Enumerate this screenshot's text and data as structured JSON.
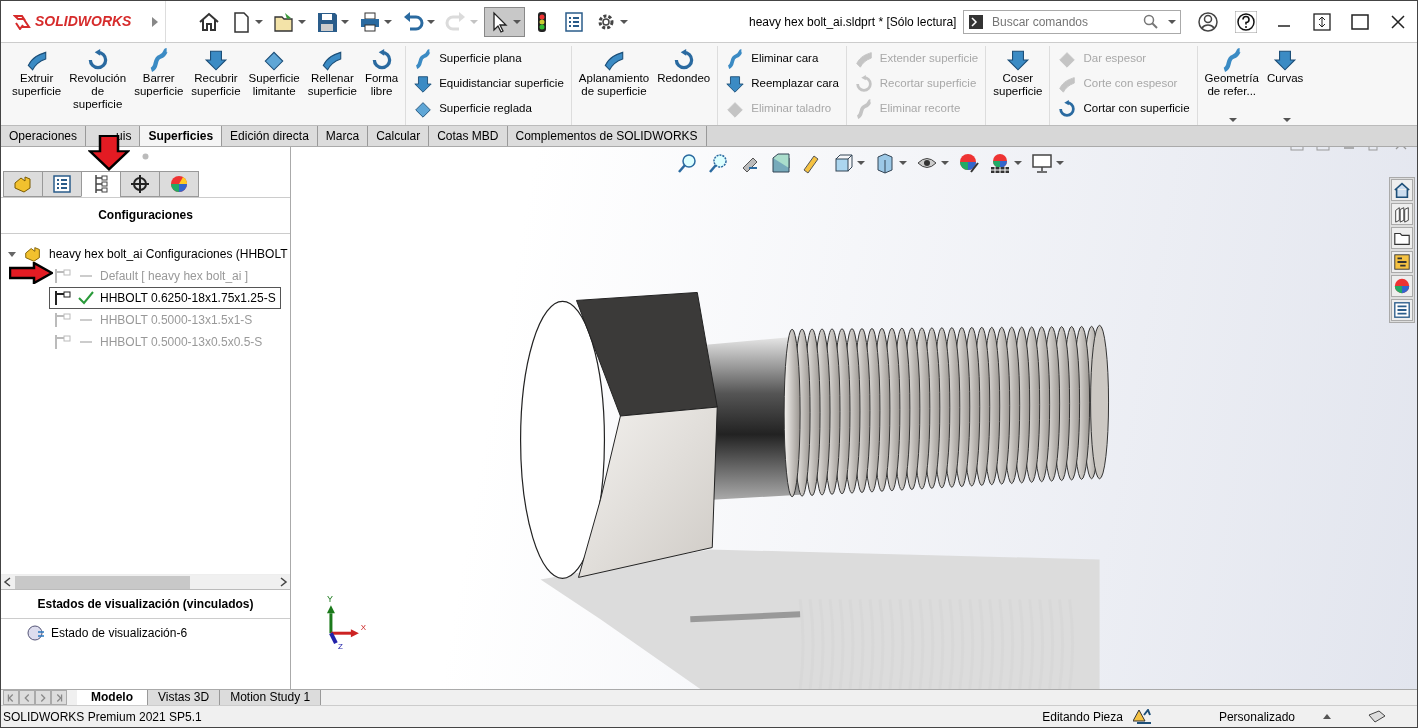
{
  "app": {
    "logo": "SOLIDWORKS",
    "title": "heavy hex bolt_ai.sldprt * [Sólo lectura]"
  },
  "quick_access": [
    {
      "disabled": false,
      "selected": false,
      "has_menu": false
    },
    {
      "disabled": false,
      "selected": false,
      "has_menu": true
    },
    {
      "disabled": false,
      "selected": false,
      "has_menu": true
    },
    {
      "disabled": false,
      "selected": false,
      "has_menu": true
    },
    {
      "disabled": false,
      "selected": false,
      "has_menu": true
    },
    {
      "disabled": false,
      "selected": false,
      "has_menu": true
    },
    {
      "disabled": true,
      "selected": false,
      "has_menu": true
    },
    {
      "disabled": false,
      "selected": true,
      "has_menu": true
    },
    {
      "disabled": false,
      "selected": false,
      "has_menu": false
    },
    {
      "disabled": false,
      "selected": false,
      "has_menu": false
    },
    {
      "disabled": false,
      "selected": false,
      "has_menu": true
    }
  ],
  "search": {
    "placeholder": "Buscar comandos"
  },
  "ribbon": [
    {
      "items": [
        {
          "kind": "large",
          "label": "Extruir superficie",
          "disabled": false
        },
        {
          "kind": "large",
          "label": "Revolución de superficie",
          "disabled": false
        },
        {
          "kind": "large",
          "label": "Barrer superficie",
          "disabled": false
        },
        {
          "kind": "large",
          "label": "Recubrir superficie",
          "disabled": false
        },
        {
          "kind": "large",
          "label": "Superficie limitante",
          "disabled": false
        },
        {
          "kind": "large",
          "label": "Rellenar superficie",
          "disabled": false
        },
        {
          "kind": "large",
          "label": "Forma libre",
          "disabled": false
        }
      ]
    },
    {
      "items": [
        {
          "kind": "small",
          "label": "Superficie plana",
          "disabled": false
        },
        {
          "kind": "small",
          "label": "Equidistanciar superficie",
          "disabled": false
        },
        {
          "kind": "small",
          "label": "Superficie reglada",
          "disabled": false
        }
      ]
    },
    {
      "items": [
        {
          "kind": "large",
          "label": "Aplanamiento de superficie",
          "disabled": false
        },
        {
          "kind": "large",
          "label": "Redondeo",
          "disabled": false
        }
      ]
    },
    {
      "items": [
        {
          "kind": "small",
          "label": "Eliminar cara",
          "disabled": false
        },
        {
          "kind": "small",
          "label": "Reemplazar cara",
          "disabled": false
        },
        {
          "kind": "small",
          "label": "Eliminar taladro",
          "disabled": true
        }
      ]
    },
    {
      "items": [
        {
          "kind": "small",
          "label": "Extender superficie",
          "disabled": true
        },
        {
          "kind": "small",
          "label": "Recortar superficie",
          "disabled": true
        },
        {
          "kind": "small",
          "label": "Eliminar recorte",
          "disabled": true
        }
      ]
    },
    {
      "items": [
        {
          "kind": "large",
          "label": "Coser superficie",
          "disabled": false
        }
      ]
    },
    {
      "items": [
        {
          "kind": "small",
          "label": "Dar espesor",
          "disabled": true
        },
        {
          "kind": "small",
          "label": "Corte con espesor",
          "disabled": true
        },
        {
          "kind": "small",
          "label": "Cortar con superficie",
          "disabled": false
        }
      ]
    },
    {
      "items": [
        {
          "kind": "large",
          "label": "Geometría de refer...",
          "disabled": false,
          "has_menu": true
        },
        {
          "kind": "large",
          "label": "Curvas",
          "disabled": false,
          "has_menu": true
        }
      ]
    }
  ],
  "command_tabs": [
    {
      "label": "Operaciones",
      "selected": false
    },
    {
      "label": "uis",
      "selected": false
    },
    {
      "label": "Superficies",
      "selected": true
    },
    {
      "label": "Edición directa",
      "selected": false
    },
    {
      "label": "Marca",
      "selected": false
    },
    {
      "label": "Calcular",
      "selected": false
    },
    {
      "label": "Cotas MBD",
      "selected": false
    },
    {
      "label": "Complementos de SOLIDWORKS",
      "selected": false
    }
  ],
  "panel_tabs": [
    {
      "selected": false
    },
    {
      "selected": false
    },
    {
      "selected": true
    },
    {
      "selected": false
    },
    {
      "selected": false
    }
  ],
  "panel": {
    "title": "Configuraciones",
    "tree": {
      "label": "heavy hex bolt_ai Configuraciones  (HHBOLT",
      "expanded": true,
      "children": [
        {
          "label": "Default [ heavy hex bolt_ai ]",
          "active": false,
          "selected": false
        },
        {
          "label": "HHBOLT 0.6250-18x1.75x1.25-S",
          "active": true,
          "selected": true
        },
        {
          "label": "HHBOLT 0.5000-13x1.5x1-S",
          "active": false,
          "selected": false
        },
        {
          "label": "HHBOLT 0.5000-13x0.5x0.5-S",
          "active": false,
          "selected": false
        }
      ]
    }
  },
  "display_states": {
    "title": "Estados de visualización (vinculados)",
    "items": [
      {
        "label": "Estado de visualización-6"
      }
    ]
  },
  "triad": {
    "x": "X",
    "y": "Y",
    "z": "Z"
  },
  "bottom_tabs": [
    {
      "label": "Modelo",
      "selected": true
    },
    {
      "label": "Vistas 3D",
      "selected": false
    },
    {
      "label": "Motion Study 1",
      "selected": false
    }
  ],
  "status_bar": {
    "product": "SOLIDWORKS Premium 2021 SP5.1",
    "mode": "Editando Pieza",
    "units": "Personalizado"
  }
}
